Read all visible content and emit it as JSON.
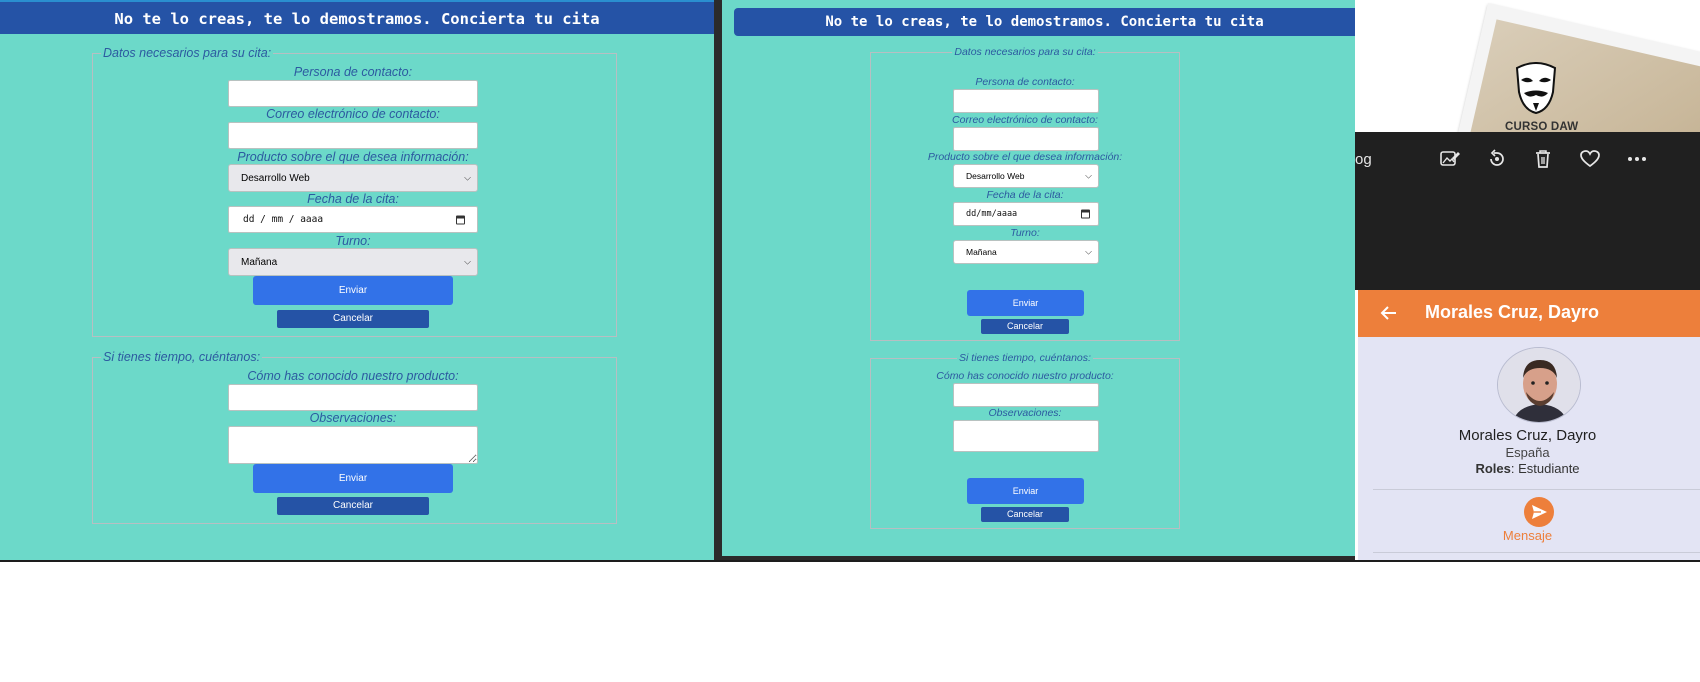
{
  "form_wide": {
    "header": "No te lo creas, te lo demostramos. Concierta tu cita",
    "section1": {
      "legend": "Datos necesarios para su cita:",
      "contact_label": "Persona de contacto:",
      "email_label": "Correo electrónico de contacto:",
      "product_label": "Producto sobre el que desea información:",
      "product_value": "Desarrollo Web",
      "date_label": "Fecha de la cita:",
      "date_placeholder": "dd / mm / aaaa",
      "shift_label": "Turno:",
      "shift_value": "Mañana",
      "send": "Enviar",
      "cancel": "Cancelar"
    },
    "section2": {
      "legend": "Si tienes tiempo, cuéntanos:",
      "how_label": "Cómo has conocido nuestro producto:",
      "notes_label": "Observaciones:",
      "send": "Enviar",
      "cancel": "Cancelar"
    }
  },
  "form_narrow": {
    "header": "No te lo creas, te lo demostramos. Concierta tu cita",
    "section1": {
      "legend": "Datos necesarios para su cita:",
      "contact_label": "Persona de contacto:",
      "email_label": "Correo electrónico de contacto:",
      "product_label": "Producto sobre el que desea información:",
      "product_value": "Desarrollo Web",
      "date_label": "Fecha de la cita:",
      "date_placeholder": "dd/mm/aaaa",
      "shift_label": "Turno:",
      "shift_value": "Mañana",
      "send": "Enviar",
      "cancel": "Cancelar"
    },
    "section2": {
      "legend": "Si tienes tiempo, cuéntanos:",
      "how_label": "Cómo has conocido nuestro producto:",
      "notes_label": "Observaciones:",
      "send": "Enviar",
      "cancel": "Cancelar"
    }
  },
  "phone": {
    "poster_text": "CURSO DAW",
    "toolbar_partial_text": "og",
    "toolbar_icons": [
      "edit-image-icon",
      "rotate-icon",
      "trash-icon",
      "heart-icon",
      "more-icon"
    ],
    "profile_header": "Morales Cruz, Dayro",
    "profile_name": "Morales Cruz, Dayro",
    "country": "España",
    "roles_label": "Roles",
    "roles_value": ": Estudiante",
    "message_label": "Mensaje",
    "accent_color": "#ed7f3b"
  },
  "colors": {
    "form_background": "#6cd9c9",
    "header_blue": "#2553a6",
    "send_button": "#3272e8",
    "label_text": "#2c5aa0"
  }
}
